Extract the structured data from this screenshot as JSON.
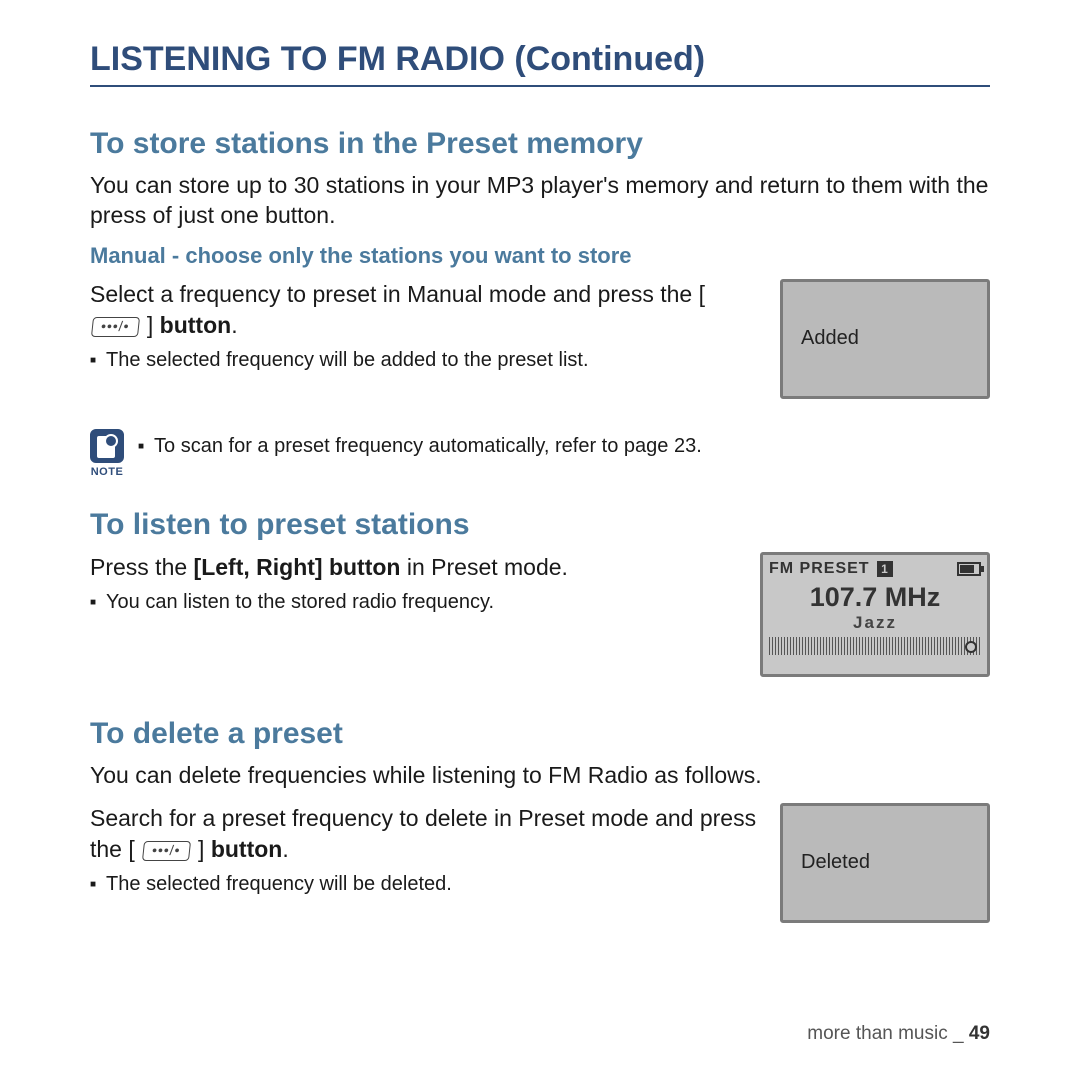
{
  "page_title": "LISTENING TO FM RADIO (Continued)",
  "section1": {
    "heading": "To store stations in the Preset memory",
    "intro": "You can store up to 30 stations in your MP3 player's memory and return to them with the press of just one button.",
    "subheading": "Manual - choose only the stations you want to store",
    "instruction_pre": "Select a frequency to preset in Manual mode and press the [ ",
    "instruction_post": " ] ",
    "instruction_bold": "button",
    "instruction_end": ".",
    "button_glyph": "•••/•",
    "bullet": "The selected frequency will be added to the preset list.",
    "screen_text": "Added"
  },
  "note": {
    "label": "NOTE",
    "text": "To scan for a preset frequency automatically, refer to page 23."
  },
  "section2": {
    "heading": "To listen to preset stations",
    "instruction_pre": "Press the ",
    "instruction_bold": "[Left, Right] button",
    "instruction_post": " in Preset mode.",
    "bullet": "You can listen to the stored radio frequency.",
    "screen": {
      "mode": "FM PRESET",
      "preset_num": "1",
      "frequency": "107.7 MHz",
      "genre": "Jazz"
    }
  },
  "section3": {
    "heading": "To delete a preset",
    "intro": "You can delete frequencies while listening to FM Radio as follows.",
    "instruction_pre": "Search for a preset frequency to delete in Preset mode and press the [ ",
    "instruction_post": " ] ",
    "instruction_bold": "button",
    "instruction_end": ".",
    "button_glyph": "•••/•",
    "bullet": "The selected frequency will be deleted.",
    "screen_text": "Deleted"
  },
  "footer": {
    "text": "more than music _ ",
    "page": "49"
  }
}
